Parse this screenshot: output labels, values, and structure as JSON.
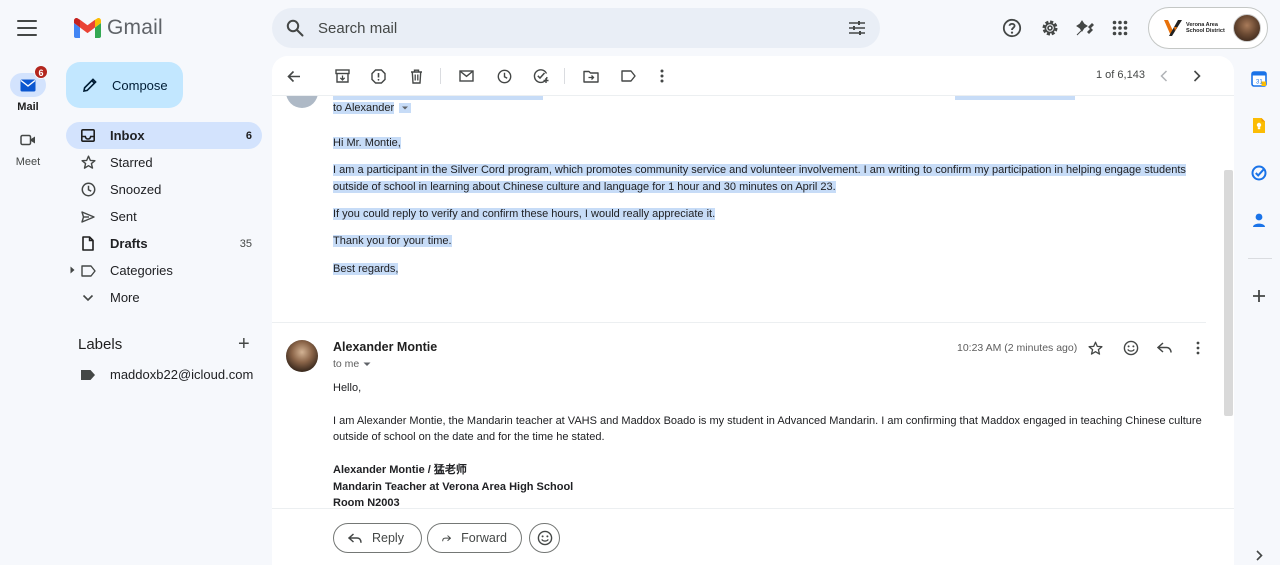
{
  "app": {
    "name": "Gmail"
  },
  "rail": {
    "mail": {
      "label": "Mail",
      "badge": "6"
    },
    "meet": {
      "label": "Meet"
    }
  },
  "search": {
    "placeholder": "Search mail"
  },
  "account": {
    "org_line1": "Verona Area",
    "org_line2": "School District"
  },
  "compose_label": "Compose",
  "nav": [
    {
      "label": "Inbox",
      "count": "6"
    },
    {
      "label": "Starred",
      "count": ""
    },
    {
      "label": "Snoozed",
      "count": ""
    },
    {
      "label": "Sent",
      "count": ""
    },
    {
      "label": "Drafts",
      "count": "35"
    },
    {
      "label": "Categories",
      "count": ""
    },
    {
      "label": "More",
      "count": ""
    }
  ],
  "labels": {
    "heading": "Labels",
    "items": [
      "maddoxb22@icloud.com"
    ]
  },
  "toolbar": {
    "pager": "1 of 6,143"
  },
  "message1": {
    "to": "to Alexander",
    "lines": [
      "Hi Mr. Montie,",
      "I am a participant in the Silver Cord program, which promotes community service and volunteer involvement. I am writing to confirm my participation in helping engage students",
      "outside of school in learning about Chinese culture and language for 1 hour and 30 minutes on April 23.",
      "If you could reply to verify and confirm these hours, I would really appreciate it.",
      "Thank you for your time.",
      "Best regards,"
    ]
  },
  "message2": {
    "sender": "Alexander Montie",
    "to": "to me",
    "time": "10:23 AM (2 minutes ago)",
    "greeting": "Hello,",
    "body_line1": "I am Alexander Montie, the Mandarin teacher at VAHS and Maddox Boado is my student in Advanced Mandarin. I am confirming that Maddox engaged in teaching Chinese culture",
    "body_line2": "outside of school on the date and for the time he stated.",
    "sig1": "Alexander Montie / 猛老师",
    "sig2": "Mandarin Teacher at Verona Area High School",
    "sig3": "Room N2003"
  },
  "actions": {
    "reply": "Reply",
    "forward": "Forward"
  },
  "colors": {
    "accent": "#0b57d0",
    "selection": "#c7dcf7",
    "compose": "#c2e7ff",
    "active_nav": "#d3e3fd",
    "badge": "#b3261e"
  }
}
